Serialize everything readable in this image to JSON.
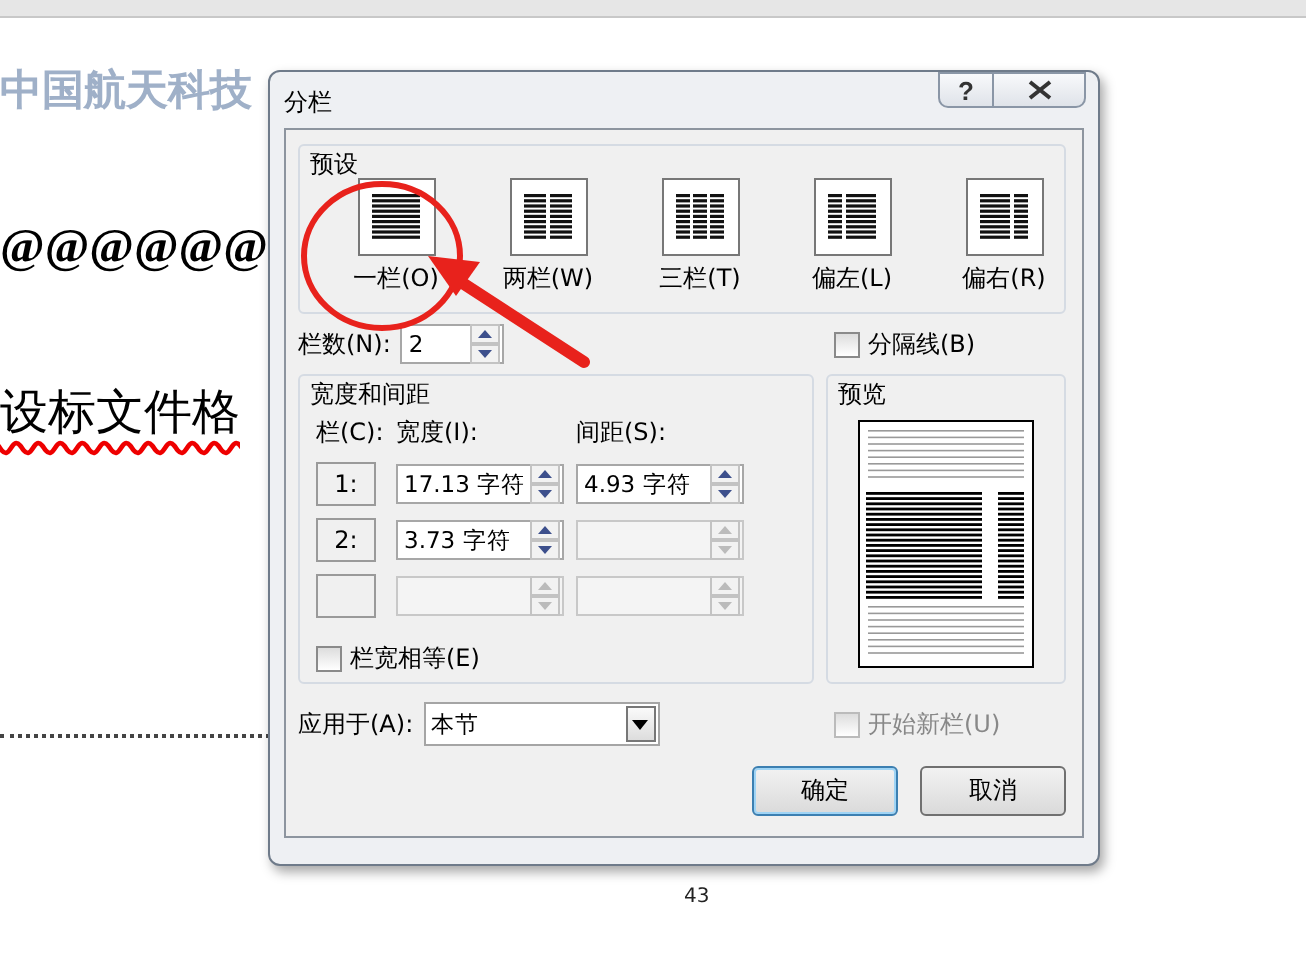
{
  "document": {
    "header": "中国航天科技",
    "lines": [
      "@@@@@@",
      "设标文件格"
    ],
    "footer": "43"
  },
  "dialog": {
    "title": "分栏",
    "help": "?",
    "presets_label": "预设",
    "presets": [
      {
        "kind": "one",
        "label": "一栏(O)"
      },
      {
        "kind": "two",
        "label": "两栏(W)"
      },
      {
        "kind": "three",
        "label": "三栏(T)"
      },
      {
        "kind": "left",
        "label": "偏左(L)"
      },
      {
        "kind": "right",
        "label": "偏右(R)"
      }
    ],
    "columns_count": {
      "label": "栏数(N):",
      "value": "2"
    },
    "separator": {
      "label": "分隔线(B)",
      "checked": false
    },
    "width_spacing": {
      "title": "宽度和间距",
      "col_header": "栏(C):",
      "width_header": "宽度(I):",
      "spacing_header": "间距(S):",
      "rows": [
        {
          "number": "1:",
          "width": {
            "value": "17.13 字符",
            "disabled": false
          },
          "spacing": {
            "value": "4.93 字符",
            "disabled": false
          }
        },
        {
          "number": "2:",
          "width": {
            "value": "3.73 字符",
            "disabled": false
          },
          "spacing": {
            "disabled": true
          }
        },
        {
          "width": {
            "disabled": true
          },
          "spacing": {
            "disabled": true
          }
        }
      ]
    },
    "equal_width": {
      "label": "栏宽相等(E)",
      "checked": false
    },
    "preview": {
      "title": "预览"
    },
    "apply_to": {
      "label": "应用于(A):",
      "value": "本节"
    },
    "start_new": {
      "label": "开始新栏(U)",
      "checked": false,
      "disabled": true
    },
    "buttons": [
      {
        "label": "确定",
        "default": true
      },
      {
        "label": "取消",
        "default": false
      }
    ]
  }
}
